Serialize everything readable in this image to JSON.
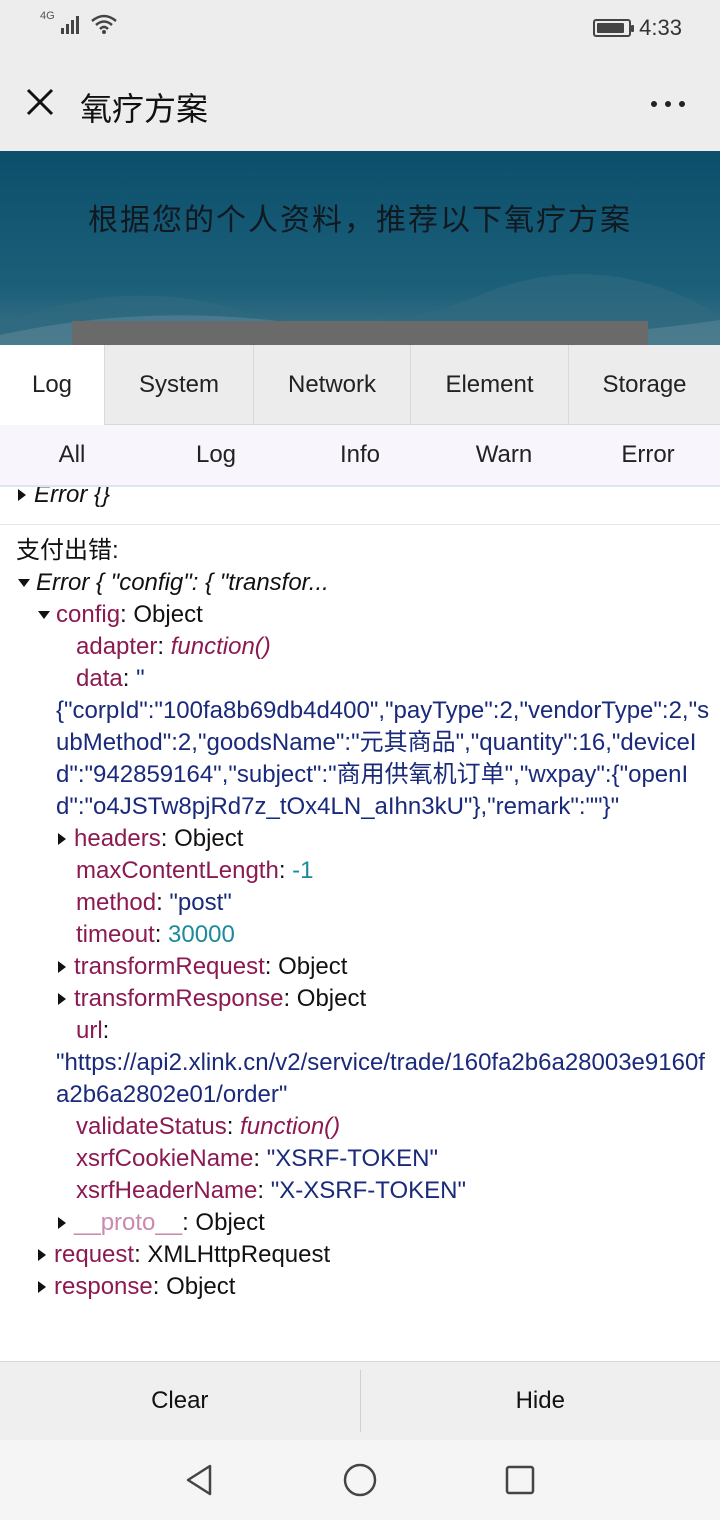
{
  "status_bar": {
    "network": "4G",
    "time": "4:33",
    "battery_level": 0.9
  },
  "header": {
    "title": "氧疗方案"
  },
  "banner": {
    "text": "根据您的个人资料，推荐以下氧疗方案"
  },
  "console": {
    "tabs": [
      "Log",
      "System",
      "Network",
      "Element",
      "Storage"
    ],
    "filters": [
      "All",
      "Log",
      "Info",
      "Warn",
      "Error"
    ],
    "entries": {
      "first": "Error {}",
      "label": "支付出错:",
      "error_summary": "Error { \"config\": { \"transfor...",
      "config_key": "config",
      "config_type": ": Object",
      "adapter_key": "adapter",
      "adapter_val": "function()",
      "data_key": "data",
      "data_quote": "\"",
      "data_val": "{\"corpId\":\"100fa8b69db4d400\",\"payType\":2,\"vendorType\":2,\"subMethod\":2,\"goodsName\":\"元其商品\",\"quantity\":16,\"deviceId\":\"942859164\",\"subject\":\"商用供氧机订单\",\"wxpay\":{\"openId\":\"o4JSTw8pjRd7z_tOx4LN_aIhn3kU\"},\"remark\":\"\"}\"",
      "headers_key": "headers",
      "object": ": Object",
      "maxlen_key": "maxContentLength",
      "maxlen_val": "-1",
      "method_key": "method",
      "method_val": "\"post\"",
      "timeout_key": "timeout",
      "timeout_val": "30000",
      "treq_key": "transformRequest",
      "tres_key": "transformResponse",
      "url_key": "url",
      "url_val": "\"https://api2.xlink.cn/v2/service/trade/160fa2b6a28003e9160fa2b6a2802e01/order\"",
      "validate_key": "validateStatus",
      "validate_val": "function()",
      "xsrfc_key": "xsrfCookieName",
      "xsrfc_val": "\"XSRF-TOKEN\"",
      "xsrfh_key": "xsrfHeaderName",
      "xsrfh_val": "\"X-XSRF-TOKEN\"",
      "proto_key": "__proto__",
      "request_key": "request",
      "request_val": ": XMLHttpRequest",
      "response_key": "response"
    },
    "footer": {
      "clear": "Clear",
      "hide": "Hide"
    }
  },
  "colors": {
    "key": "#8b1a52",
    "string": "#1a2a7a",
    "number": "#1b8a9a",
    "banner": "#0b4f6c"
  },
  "icons": [
    "signal-icon",
    "wifi-icon",
    "battery-icon",
    "close-icon",
    "more-icon",
    "back-icon",
    "home-icon",
    "recents-icon"
  ]
}
